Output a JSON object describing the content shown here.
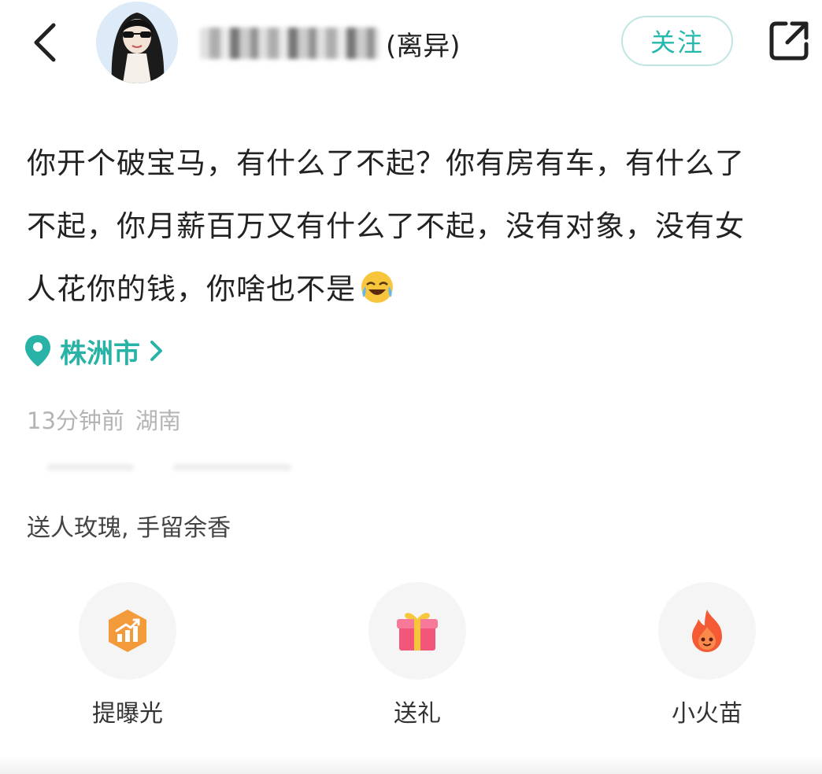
{
  "header": {
    "username_suffix": "(离异)",
    "follow_label": "关注"
  },
  "post": {
    "lines": [
      "你开个破宝马，有什么了不起？你有房有车，有什么了",
      "不起，你月薪百万又有什么了不起，没有对象，没有女",
      "人花你的钱，你啥也不是"
    ],
    "emoji": "laughing-crying-emoji"
  },
  "location": {
    "label": "株洲市"
  },
  "meta": {
    "time": "13分钟前",
    "region": "湖南"
  },
  "gift_prompt": "送人玫瑰, 手留余香",
  "actions": [
    {
      "label": "提曝光",
      "icon": "boost-exposure-icon",
      "color": "#f39a3a"
    },
    {
      "label": "送礼",
      "icon": "gift-icon",
      "color": "#f2577a"
    },
    {
      "label": "小火苗",
      "icon": "flame-icon",
      "color": "#f45a34"
    }
  ],
  "colors": {
    "accent": "#29b3a6",
    "follow_border": "#bfe6e2",
    "meta_gray": "#b4b4b4"
  }
}
